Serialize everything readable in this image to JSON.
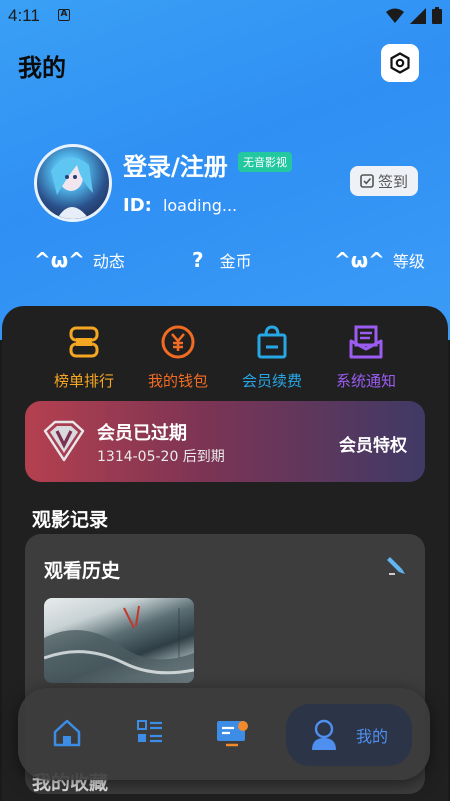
{
  "status_bar": {
    "time": "4:11",
    "a_icon": "A"
  },
  "header": {
    "title": "我的"
  },
  "profile": {
    "login_text": "登录/注册",
    "app_badge": "无音影视",
    "id_label": "ID:",
    "id_value": "loading...",
    "checkin_label": "签到"
  },
  "stats": [
    {
      "glyph": "^ω^",
      "label": "动态"
    },
    {
      "glyph": "?",
      "label": "金币"
    },
    {
      "glyph": "^ω^",
      "label": "等级"
    }
  ],
  "quick_actions": [
    {
      "label": "榜单排行",
      "color": "#f5a623"
    },
    {
      "label": "我的钱包",
      "color": "#f26b23"
    },
    {
      "label": "会员续费",
      "color": "#27a7e6"
    },
    {
      "label": "系统通知",
      "color": "#9b5cf2"
    }
  ],
  "vip": {
    "title": "会员已过期",
    "expiry": "1314-05-20 后到期",
    "privilege_label": "会员特权"
  },
  "section_title": "观影记录",
  "history": {
    "title": "观看历史"
  },
  "bottom_partial_text": "我的收藏",
  "tabbar": {
    "active_label": "我的",
    "accent_color": "#4e8ff0"
  }
}
